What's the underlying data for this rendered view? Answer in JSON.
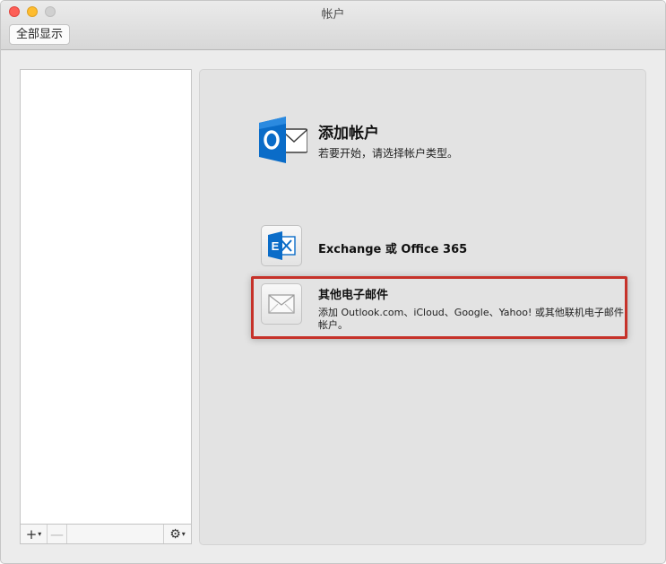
{
  "window": {
    "title": "帐户",
    "show_all_label": "全部显示"
  },
  "sidebar": {
    "toolbar": {
      "add_symbol": "+",
      "remove_symbol": "—",
      "gear_symbol": "⚙"
    }
  },
  "main": {
    "heading": "添加帐户",
    "subheading": "若要开始，请选择帐户类型。",
    "options": [
      {
        "label": "Exchange 或 Office 365",
        "icon": "exchange-icon"
      },
      {
        "label": "其他电子邮件",
        "description": "添加 Outlook.com、iCloud、Google、Yahoo! 或其他联机电子邮件帐户。",
        "icon": "envelope-icon",
        "highlighted": true
      }
    ]
  },
  "colors": {
    "outlook_blue": "#0a6cc8",
    "highlight_red": "#c6322a"
  }
}
